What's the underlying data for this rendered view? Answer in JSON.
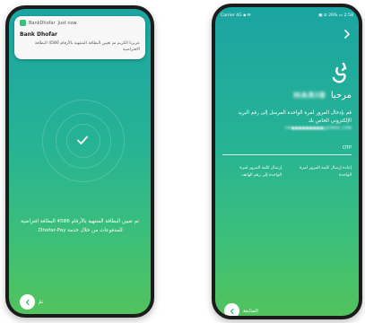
{
  "left_phone": {
    "notification": {
      "app_name": "BankDhofar",
      "time": "Just now",
      "title": "Bank Dhofar",
      "body": "عزيزنا الكريم تم تعيين البطاقة المنتهية بالأرقام 4586 البطاقة الافتراضية"
    },
    "success_message": "تم تعيين البطاقة المنتهية بالأرقام 4586 البطاقة افتراضية للمدفوعات من خلال خدمة Dhofar-Pay.",
    "back_label": "تمّ"
  },
  "right_phone": {
    "status_left": "Carrier 4G ▪ ✉",
    "status_right": "▣ ⊘ 26% ▭ 2:58",
    "welcome": "مرحبا",
    "name": "HARIB",
    "instruction": "قم بإدخال المرور لمرة الواحدة المرسل إلى رقم البريد الإلكتروني الخاص بك",
    "email": "HA●●●●●●●●●@GMAIL.COM",
    "otp_label": "OTP",
    "resend_link": "إعادة إرسال كلمة المرور لمرة الواحدة",
    "send_phone_link": "إرسال كلمة المرور لمرة الواحدة إلى رقم الهاتف",
    "continue_label": "المتابعة"
  },
  "colors": {
    "gradient_top": "#1aa5a3",
    "gradient_bottom": "#52c35e",
    "icon_green": "#3cbf79"
  }
}
